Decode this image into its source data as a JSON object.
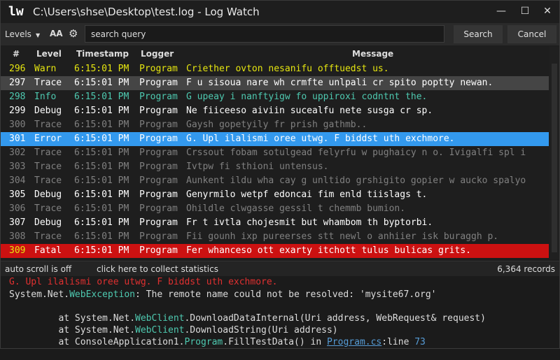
{
  "window": {
    "logo": "lw",
    "title": "C:\\Users\\shse\\Desktop\\test.log - Log Watch",
    "minimize_glyph": "—",
    "maximize_glyph": "☐",
    "close_glyph": "✕"
  },
  "toolbar": {
    "levels_label": "Levels",
    "levels_caret": "▼",
    "font_button": "AA",
    "settings_icon": "gear-icon",
    "search_value": "search query",
    "search_label": "Search",
    "cancel_label": "Cancel"
  },
  "grid": {
    "columns": [
      "#",
      "Level",
      "Timestamp",
      "Logger",
      "Message"
    ],
    "rows": [
      {
        "num": "296",
        "level": "Warn",
        "ts": "6:15:01 PM",
        "logger": "Program",
        "msg": "Criether ovton nesanifu offtuedst us.",
        "color": "#e5e510",
        "bg": ""
      },
      {
        "num": "297",
        "level": "Trace",
        "ts": "6:15:01 PM",
        "logger": "Program",
        "msg": "F u sisoua nare wh crmfte unlpali cr spito poptty newan.",
        "color": "#ffffff",
        "bg": "#454545"
      },
      {
        "num": "298",
        "level": "Info",
        "ts": "6:15:01 PM",
        "logger": "Program",
        "msg": "G upeay i nanftyigw fo uppiroxi codntnt the.",
        "color": "#4ec9b0",
        "bg": ""
      },
      {
        "num": "299",
        "level": "Debug",
        "ts": "6:15:01 PM",
        "logger": "Program",
        "msg": "Ne fiiceeso aiviin sucealfu nete susga cr sp.",
        "color": "#ffffff",
        "bg": ""
      },
      {
        "num": "300",
        "level": "Trace",
        "ts": "6:15:01 PM",
        "logger": "Program",
        "msg": "Gaysh gopetyily fr prish gathmb..",
        "color": "#808080",
        "bg": ""
      },
      {
        "num": "301",
        "level": "Error",
        "ts": "6:15:01 PM",
        "logger": "Program",
        "msg": "G. Upl ilalismi oree utwg. F biddst uth exchmore.",
        "color": "#ffffff",
        "bg": "#3399ee"
      },
      {
        "num": "302",
        "level": "Trace",
        "ts": "6:15:01 PM",
        "logger": "Program",
        "msg": "Crssout fobam sotulgead felyrfu w pughaicy n o. Ivigalfi spl i",
        "color": "#808080",
        "bg": ""
      },
      {
        "num": "303",
        "level": "Trace",
        "ts": "6:15:01 PM",
        "logger": "Program",
        "msg": "Ivtpw fi sthioni untensus.",
        "color": "#808080",
        "bg": ""
      },
      {
        "num": "304",
        "level": "Trace",
        "ts": "6:15:01 PM",
        "logger": "Program",
        "msg": "Aunkent ildu wha cay g unltido grshigito gopier w aucko spalyo",
        "color": "#808080",
        "bg": ""
      },
      {
        "num": "305",
        "level": "Debug",
        "ts": "6:15:01 PM",
        "logger": "Program",
        "msg": "Genyrmilo wetpf edoncai fim enld tiislags t.",
        "color": "#ffffff",
        "bg": ""
      },
      {
        "num": "306",
        "level": "Trace",
        "ts": "6:15:01 PM",
        "logger": "Program",
        "msg": "Ohildle clwgasse gessil t chemmb bumion.",
        "color": "#808080",
        "bg": ""
      },
      {
        "num": "307",
        "level": "Debug",
        "ts": "6:15:01 PM",
        "logger": "Program",
        "msg": "Fr t ivtla chojesmit but whambom th byptorbi.",
        "color": "#ffffff",
        "bg": ""
      },
      {
        "num": "308",
        "level": "Trace",
        "ts": "6:15:01 PM",
        "logger": "Program",
        "msg": "Fii gounh ixp pureerses stt newl o anhiier isk buraggh p.",
        "color": "#808080",
        "bg": ""
      },
      {
        "num": "309",
        "level": "Fatal",
        "ts": "6:15:01 PM",
        "logger": "Program",
        "msg": "Fer whanceso ott exarty itchott tulus bulicas grits.",
        "color": "#ffffff",
        "bg": "#cc1111",
        "color_num": "#e5e510"
      }
    ]
  },
  "status": {
    "autoscroll": "auto scroll is off",
    "collect": "click here to collect statistics",
    "records": "6,364 records"
  },
  "detail": {
    "message": "G. Upl ilalismi oree utwg. F biddst uth exchmore.",
    "message_color": "#e03030",
    "ex_prefix": "System.Net.",
    "ex_type": "WebException",
    "ex_text": ": The remote name could not be resolved: 'mysite67.org'",
    "frame1_a": "   at System.Net.",
    "frame1_type": "WebClient",
    "frame1_b": ".DownloadDataInternal(Uri address, WebRequest& request)",
    "frame2_a": "   at System.Net.",
    "frame2_type": "WebClient",
    "frame2_b": ".DownloadString(Uri address)",
    "frame3_a": "   at ConsoleApplication1.",
    "frame3_type": "Program",
    "frame3_b": ".FillTestData() in ",
    "frame3_file": "Program.cs",
    "frame3_c": ":line ",
    "frame3_line": "73"
  }
}
